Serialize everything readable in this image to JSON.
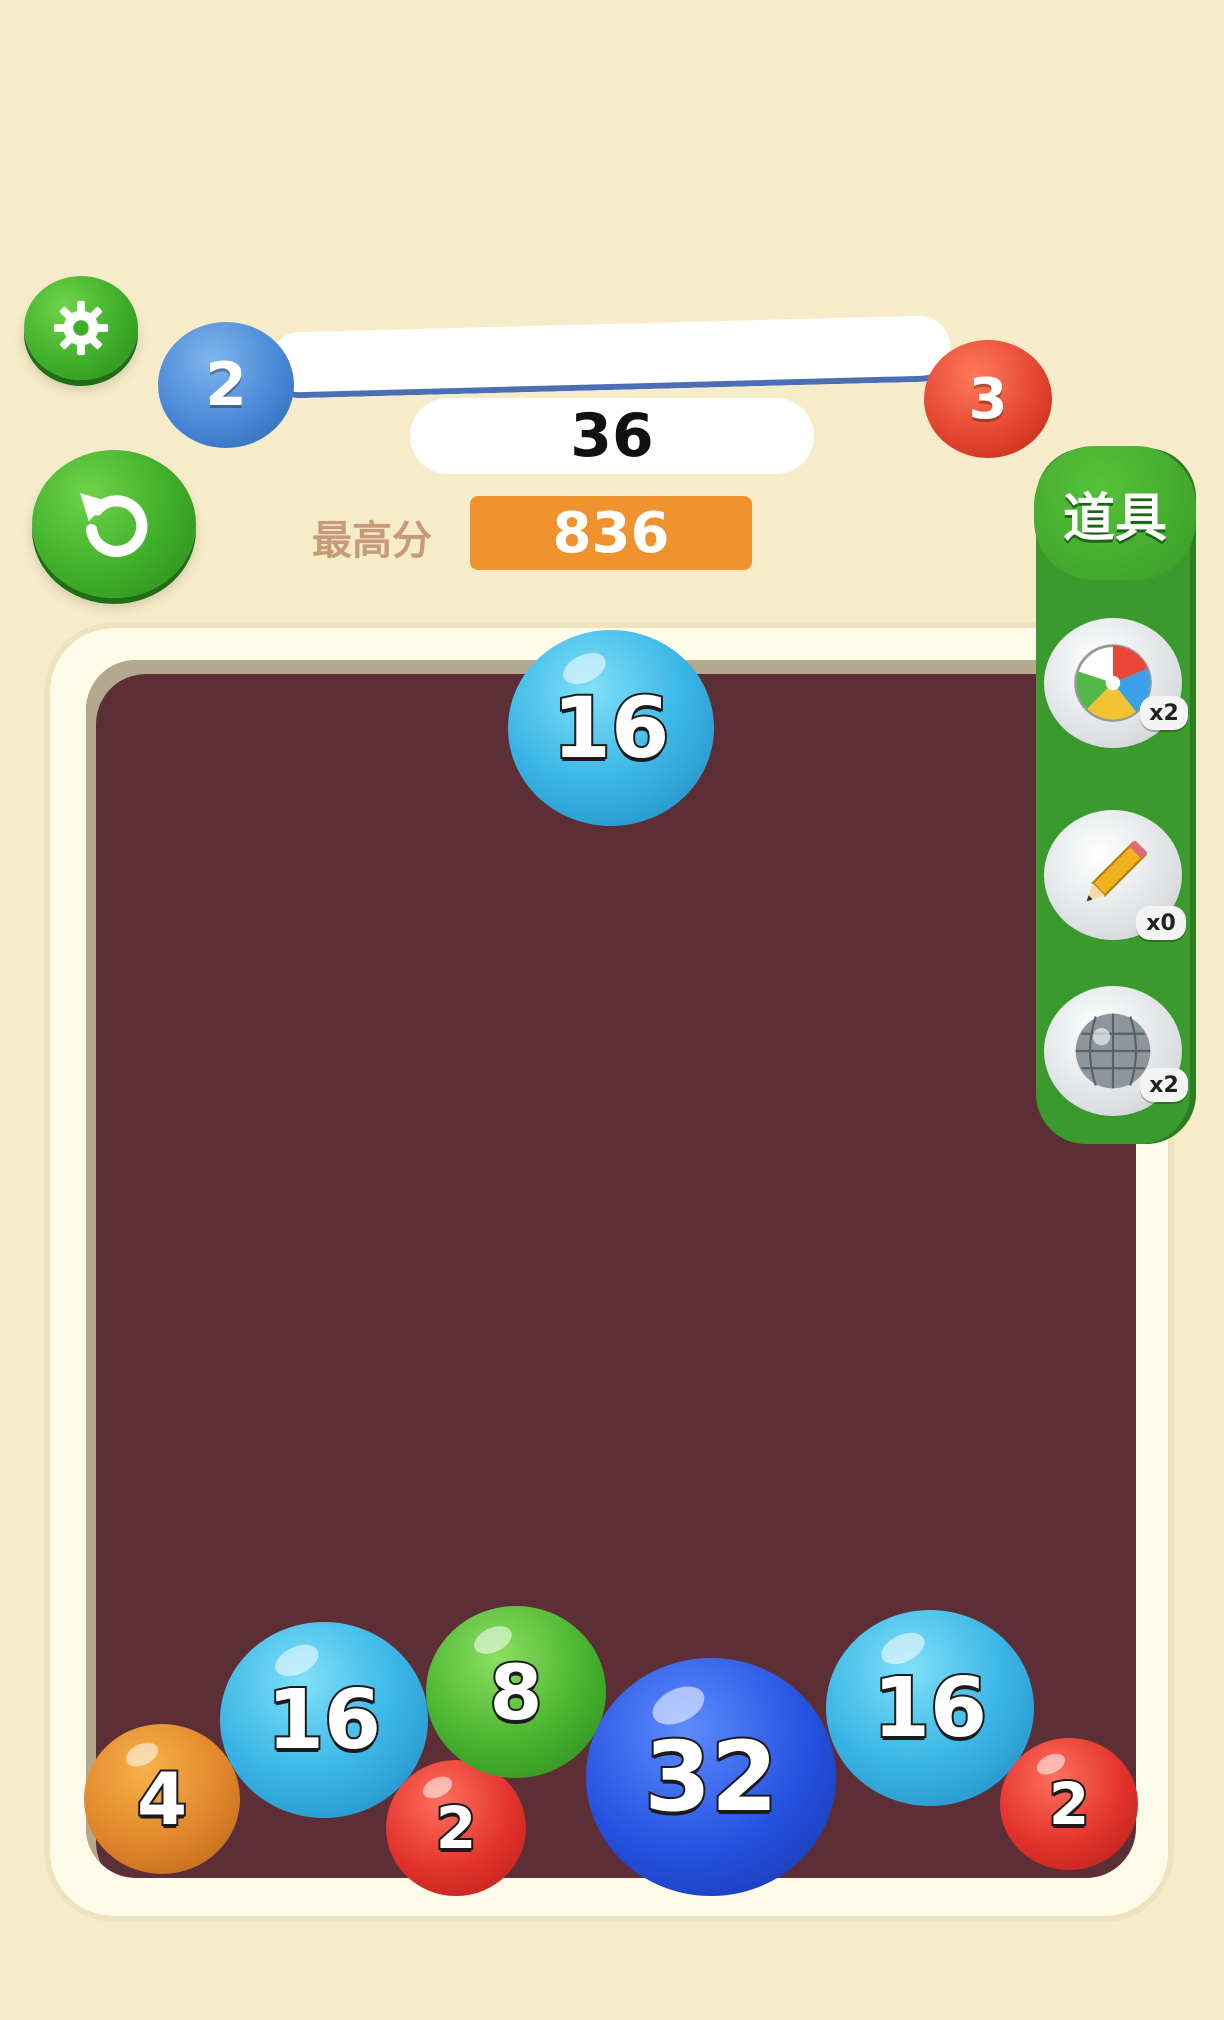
{
  "level": {
    "current": "2",
    "next": "3"
  },
  "score": {
    "current": "36",
    "best_label": "最高分",
    "best_value": "836"
  },
  "tools": {
    "header": "道具",
    "items": [
      {
        "name": "beach-ball",
        "count": "x2"
      },
      {
        "name": "pencil",
        "count": "x0"
      },
      {
        "name": "disco-ball",
        "count": "x2"
      }
    ]
  },
  "board": {
    "drop_ball": "16",
    "balls": [
      "4",
      "16",
      "2",
      "8",
      "32",
      "16",
      "2"
    ]
  },
  "icons": {
    "settings": "gear-icon",
    "restart": "restart-icon"
  },
  "colors": {
    "background": "#f7ecca",
    "board": "#5c2f36",
    "accent_green": "#3fae2a",
    "best_score": "#f0922e"
  }
}
